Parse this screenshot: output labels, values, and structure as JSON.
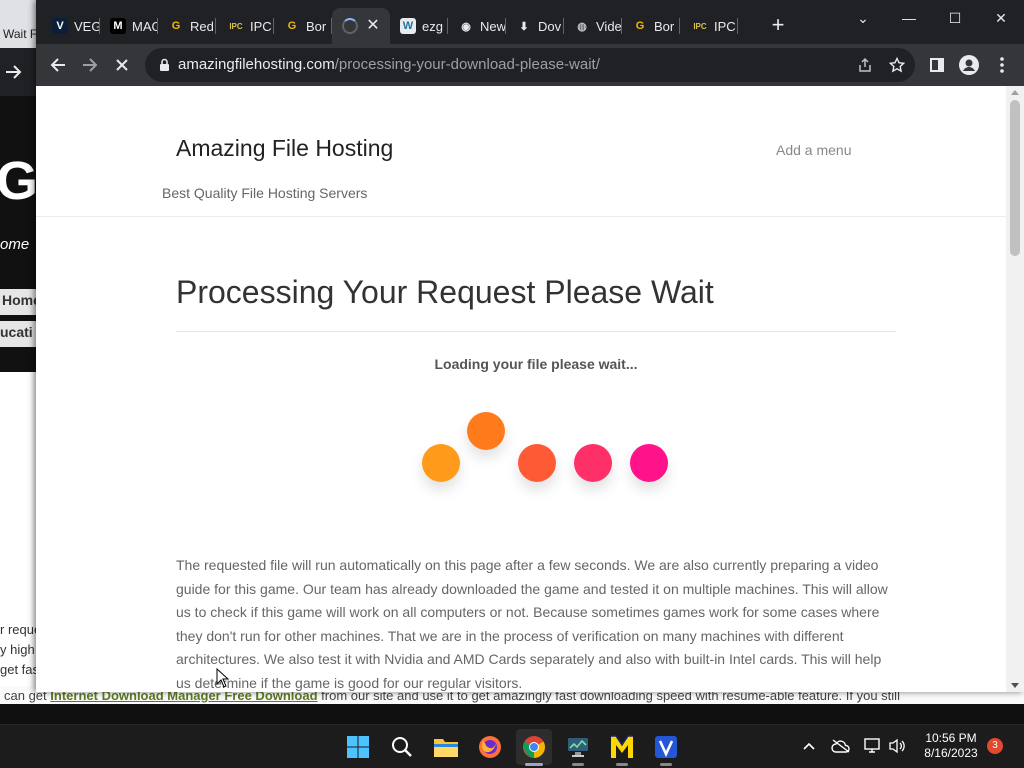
{
  "background_window": {
    "tab_text": "Wait F",
    "big_letter": "G",
    "welcome_text": "ome",
    "menu_home": "Home",
    "menu_education": "ucati",
    "para_lines": [
      "r reque",
      "y high",
      "get fast"
    ],
    "bottom_prefix": "can get",
    "bottom_link": "Internet Download Manager Free Download",
    "bottom_suffix": "from our site and use it to get amazingly fast downloading speed with resume-able feature. If you still"
  },
  "tabs": [
    {
      "label": "VEG",
      "icon": "v-icon",
      "fav": "V",
      "fav_color": "#0b1f3a",
      "fav_text": "#ffffff"
    },
    {
      "label": "MAG",
      "icon": "m-logo-icon",
      "fav": "M",
      "fav_color": "#000000",
      "fav_text": "#ffffff"
    },
    {
      "label": "Red",
      "icon": "g-logo-icon",
      "fav": "G",
      "fav_color": "transparent",
      "fav_text": "#f2b705"
    },
    {
      "label": "IPC",
      "icon": "ipc-games-icon",
      "fav": "IPC",
      "fav_color": "transparent",
      "fav_text": "#d7c24a"
    },
    {
      "label": "Bor",
      "icon": "g-logo-icon",
      "fav": "G",
      "fav_color": "transparent",
      "fav_text": "#f2b705"
    },
    {
      "label": "",
      "icon": "loading-spinner-icon",
      "fav": "",
      "fav_color": "transparent",
      "fav_text": "#8ab4f8"
    },
    {
      "label": "ezg",
      "icon": "wordpress-icon",
      "fav": "W",
      "fav_color": "#e8eaed",
      "fav_text": "#21759b"
    },
    {
      "label": "New",
      "icon": "chrome-icon",
      "fav": "◉",
      "fav_color": "transparent",
      "fav_text": "#e8eaed"
    },
    {
      "label": "Dov",
      "icon": "download-icon",
      "fav": "⬇",
      "fav_color": "transparent",
      "fav_text": "#e8eaed"
    },
    {
      "label": "Vide",
      "icon": "globe-icon",
      "fav": "◍",
      "fav_color": "transparent",
      "fav_text": "#bdc1c6"
    },
    {
      "label": "Bor",
      "icon": "g-logo-icon",
      "fav": "G",
      "fav_color": "transparent",
      "fav_text": "#f2b705"
    },
    {
      "label": "IPC",
      "icon": "ipc-games-icon",
      "fav": "IPC",
      "fav_color": "transparent",
      "fav_text": "#d7c24a"
    }
  ],
  "active_tab_index": 5,
  "newtab_glyph": "+",
  "window_controls": {
    "tabsearch": "⌄",
    "minimize": "—",
    "maximize": "☐",
    "close": "✕"
  },
  "address": {
    "domain": "amazingfilehosting.com",
    "path": "/processing-your-download-please-wait/"
  },
  "page": {
    "site_title": "Amazing File Hosting",
    "tagline": "Best Quality File Hosting Servers",
    "menu_link": "Add a menu",
    "heading": "Processing Your Request Please Wait",
    "loading_text": "Loading your file please wait...",
    "dots_colors": [
      "#ff9a1a",
      "#ff7a1a",
      "#ff5a36",
      "#ff3068",
      "#ff128a"
    ],
    "body_paragraph": "The requested file will run automatically on this page after a few seconds. We are also currently preparing a video guide for this game. Our team has already downloaded the game and tested it on multiple machines. This will allow us to check if this game will work on all computers or not. Because sometimes games work for some cases where they don't run for other machines. That we are in the process of verification on many machines with different architectures. We also test it with Nvidia and AMD Cards separately and also with built-in Intel cards. This will help us determine if the game is good for our regular visitors."
  },
  "taskbar": {
    "apps": [
      "windows-start-icon",
      "search-icon",
      "file-explorer-icon",
      "firefox-icon",
      "chrome-icon",
      "network-monitor-icon",
      "yellow-m-app-icon",
      "v-app-icon"
    ],
    "time": "10:56 PM",
    "date": "8/16/2023",
    "notifications": "3"
  }
}
